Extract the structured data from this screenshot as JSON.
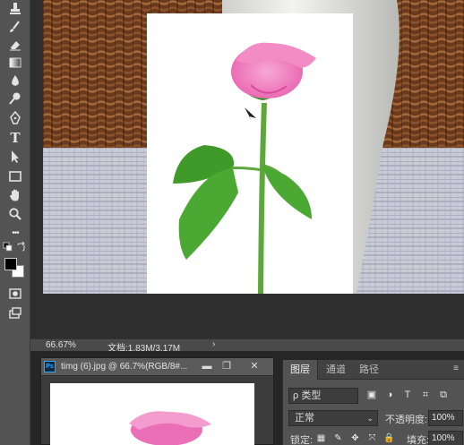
{
  "toolbar": {
    "tools": [
      "stamp-tool",
      "history-brush-tool",
      "eraser-tool",
      "gradient-tool",
      "blur-tool",
      "dodge-tool",
      "pen-tool",
      "type-tool",
      "path-selection-tool",
      "rectangle-tool",
      "hand-tool",
      "zoom-tool",
      "more-tools"
    ],
    "type_tool_glyph": "T",
    "more_tools_glyph": "•••",
    "foreground_color": "#000000",
    "background_color": "#ffffff"
  },
  "statusbar": {
    "zoom": "66.67%",
    "doc_info": "文档:1.83M/3.17M",
    "arrow": "›"
  },
  "document_window": {
    "badge": "Ps",
    "title": "timg (6).jpg @ 66.7%(RGB/8#...",
    "minimize": "▬",
    "restore": "❐",
    "close": "✕"
  },
  "layers_panel": {
    "tabs": [
      "图层",
      "通道",
      "路径"
    ],
    "menu_icon": "≡",
    "filter_label": "ρ 类型",
    "filter_icons": [
      "▣",
      "◑",
      "T",
      "⌗",
      "⧉"
    ],
    "blend_mode": "正常",
    "opacity_label": "不透明度:",
    "opacity_value": "100%",
    "lock_label": "锁定:",
    "lock_icons": [
      "▦",
      "✎",
      "✥",
      "⤧",
      "🔒"
    ],
    "fill_label": "填充:",
    "fill_value": "100%"
  },
  "colors": {
    "app_bg": "#282828",
    "panel_bg": "#535353",
    "accent_ps": "#31a8ff"
  }
}
